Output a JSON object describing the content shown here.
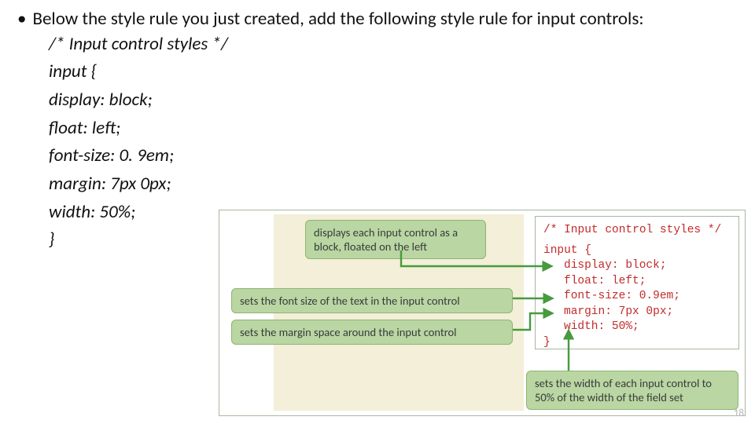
{
  "bullet": {
    "text": "Below the style rule you just created, add the following style rule for input controls:"
  },
  "code_lines": [
    "/* Input control styles */",
    "input {",
    "display: block;",
    "float: left;",
    "font-size: 0. 9em;",
    "margin: 7px 0px;",
    "width: 50%;",
    "}"
  ],
  "figure": {
    "code": {
      "comment": "/* Input control styles */",
      "selector": "input {",
      "l1": "display: block;",
      "l2": "float: left;",
      "l3": "font-size: 0.9em;",
      "l4": "margin: 7px 0px;",
      "l5": "width: 50%;",
      "close": "}"
    },
    "callouts": {
      "c1": "displays each input control as a block, floated on the left",
      "c2": "sets the font size of the text in the input control",
      "c3": "sets the margin space around the input control",
      "c4": "sets the width of each input control to 50% of the width of the field set"
    }
  },
  "page_number": "18"
}
